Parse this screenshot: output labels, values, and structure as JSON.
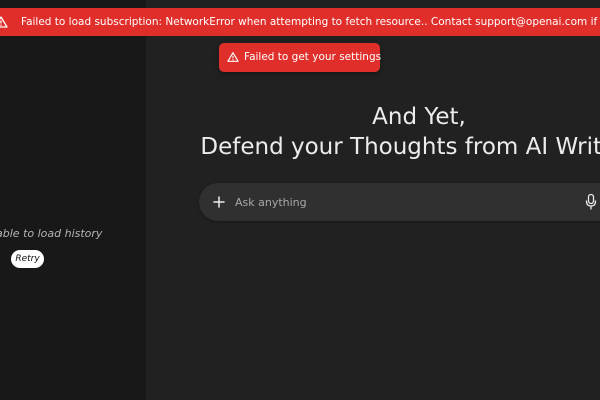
{
  "banner": {
    "message": "Failed to load subscription: NetworkError when attempting to fetch resource.. Contact support@openai.com if error persists.",
    "icon": "warning-icon",
    "color": "#e02e2a"
  },
  "toast": {
    "message": "Failed to get your settings",
    "icon": "warning-icon",
    "color": "#e02e2a"
  },
  "sidebar": {
    "history_error": "Unable to load history",
    "retry_label": "Retry"
  },
  "hero": {
    "line1": "And Yet,",
    "line2": "Defend your Thoughts from AI Writing"
  },
  "composer": {
    "placeholder": "Ask anything",
    "plus_icon": "plus-icon",
    "mic_icon": "microphone-icon"
  }
}
